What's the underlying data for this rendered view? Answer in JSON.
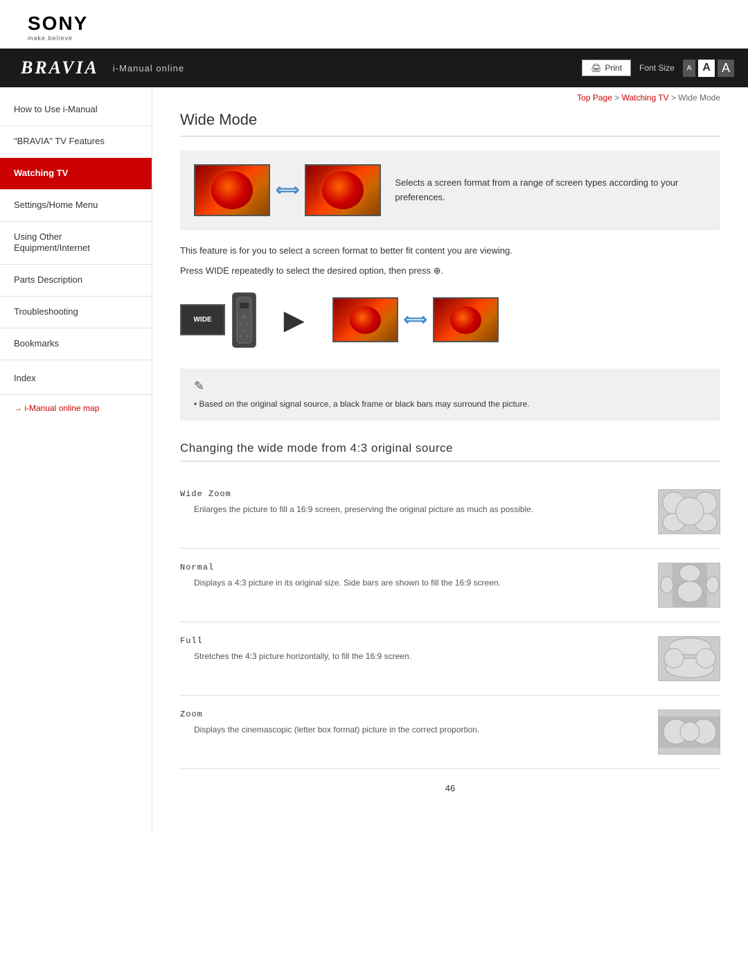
{
  "logo": {
    "brand": "SONY",
    "tagline": "make.believe"
  },
  "header": {
    "bravia": "BRAVIA",
    "manual": "i-Manual online",
    "print_label": "Print",
    "font_size_label": "Font Size",
    "font_sizes": [
      "A",
      "A",
      "A"
    ]
  },
  "breadcrumb": {
    "top_page": "Top Page",
    "separator": " > ",
    "watching_tv": "Watching TV",
    "current": "Wide Mode"
  },
  "sidebar": {
    "items": [
      {
        "id": "how-to-use",
        "label": "How to Use i-Manual",
        "active": false
      },
      {
        "id": "bravia-features",
        "label": "\"BRAVIA\" TV Features",
        "active": false
      },
      {
        "id": "watching-tv",
        "label": "Watching TV",
        "active": true
      },
      {
        "id": "settings-home",
        "label": "Settings/Home Menu",
        "active": false
      },
      {
        "id": "using-other",
        "label": "Using Other Equipment/Internet",
        "active": false
      },
      {
        "id": "parts-desc",
        "label": "Parts Description",
        "active": false
      },
      {
        "id": "troubleshooting",
        "label": "Troubleshooting",
        "active": false
      },
      {
        "id": "bookmarks",
        "label": "Bookmarks",
        "active": false
      },
      {
        "id": "index",
        "label": "Index",
        "active": false
      }
    ],
    "map_link": "→ i-Manual online map"
  },
  "content": {
    "page_title": "Wide Mode",
    "intro_description": "Selects a screen format from a range of screen types according to your preferences.",
    "body_text_1": "This feature is for you to select a screen format to better fit content you are viewing.",
    "body_text_2": "Press WIDE repeatedly to select the desired option, then press ⊕.",
    "note_text": "Based on the original signal source, a black frame or black bars may surround the picture.",
    "wide_button_label": "WIDE",
    "section_heading": "Changing the wide mode from 4:3 original source",
    "modes": [
      {
        "name": "Wide Zoom",
        "description": "Enlarges the picture to fill a 16:9 screen, preserving the original picture as much as possible."
      },
      {
        "name": "Normal",
        "description": "Displays a 4:3 picture in its original size. Side bars are shown to fill the 16:9 screen."
      },
      {
        "name": "Full",
        "description": "Stretches the 4:3 picture horizontally, to fill the 16:9 screen."
      },
      {
        "name": "Zoom",
        "description": "Displays the cinemascopic (letter box format) picture in the correct proportion."
      }
    ],
    "page_number": "46"
  }
}
